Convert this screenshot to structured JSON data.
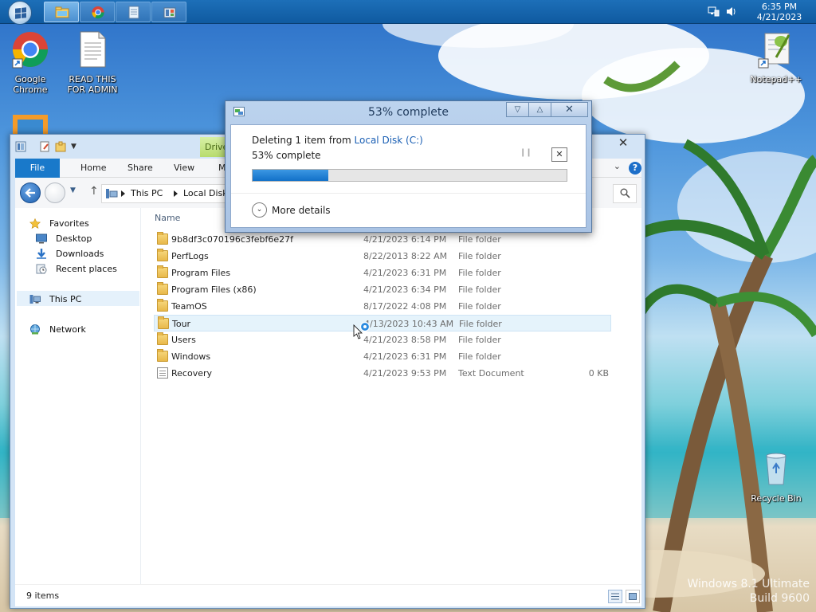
{
  "desktop": {
    "icons": [
      {
        "label": "Google Chrome"
      },
      {
        "label": "READ THIS FOR ADMIN"
      },
      {
        "label": "Notepad++"
      },
      {
        "label": "Recycle Bin"
      }
    ],
    "watermark": {
      "line1": "Windows 8.1 Ultimate",
      "line2": "Build 9600"
    }
  },
  "taskbar": {
    "apps": [
      "file-explorer-icon",
      "chrome-icon",
      "notepad-icon",
      "control-panel-icon"
    ],
    "clock": {
      "time": "6:35 PM",
      "date": "4/21/2023"
    }
  },
  "explorer": {
    "drive_tab": "Drive",
    "ribbon_tabs": [
      "File",
      "Home",
      "Share",
      "View",
      "Manage"
    ],
    "address": {
      "seg1": "This PC",
      "seg2": "Local Disk (C:)"
    },
    "nav_pane": {
      "favorites": "Favorites",
      "desktop": "Desktop",
      "downloads": "Downloads",
      "recent": "Recent places",
      "this_pc": "This PC",
      "network": "Network"
    },
    "column_name": "Name",
    "rows": [
      {
        "name": "9b8df3c070196c3febf6e27f",
        "date": "4/21/2023 6:14 PM",
        "type": "File folder",
        "size": ""
      },
      {
        "name": "PerfLogs",
        "date": "8/22/2013 8:22 AM",
        "type": "File folder",
        "size": ""
      },
      {
        "name": "Program Files",
        "date": "4/21/2023 6:31 PM",
        "type": "File folder",
        "size": ""
      },
      {
        "name": "Program Files (x86)",
        "date": "4/21/2023 6:34 PM",
        "type": "File folder",
        "size": ""
      },
      {
        "name": "TeamOS",
        "date": "8/17/2022 4:08 PM",
        "type": "File folder",
        "size": ""
      },
      {
        "name": "Tour",
        "date": "4/13/2023 10:43 AM",
        "type": "File folder",
        "size": ""
      },
      {
        "name": "Users",
        "date": "4/21/2023 8:58 PM",
        "type": "File folder",
        "size": ""
      },
      {
        "name": "Windows",
        "date": "4/21/2023 6:31 PM",
        "type": "File folder",
        "size": ""
      },
      {
        "name": "Recovery",
        "date": "4/21/2023 9:53 PM",
        "type": "Text Document",
        "size": "0 KB"
      }
    ],
    "status_count": "9 items"
  },
  "dialog": {
    "title": "53% complete",
    "action_prefix": "Deleting 1 item from ",
    "location": "Local Disk (C:)",
    "percent_text": "53% complete",
    "progress_fraction": 0.24,
    "more_details": "More details"
  },
  "colors": {
    "accent": "#1979ca",
    "progress": "#1170c8",
    "link": "#1a5fb4"
  }
}
